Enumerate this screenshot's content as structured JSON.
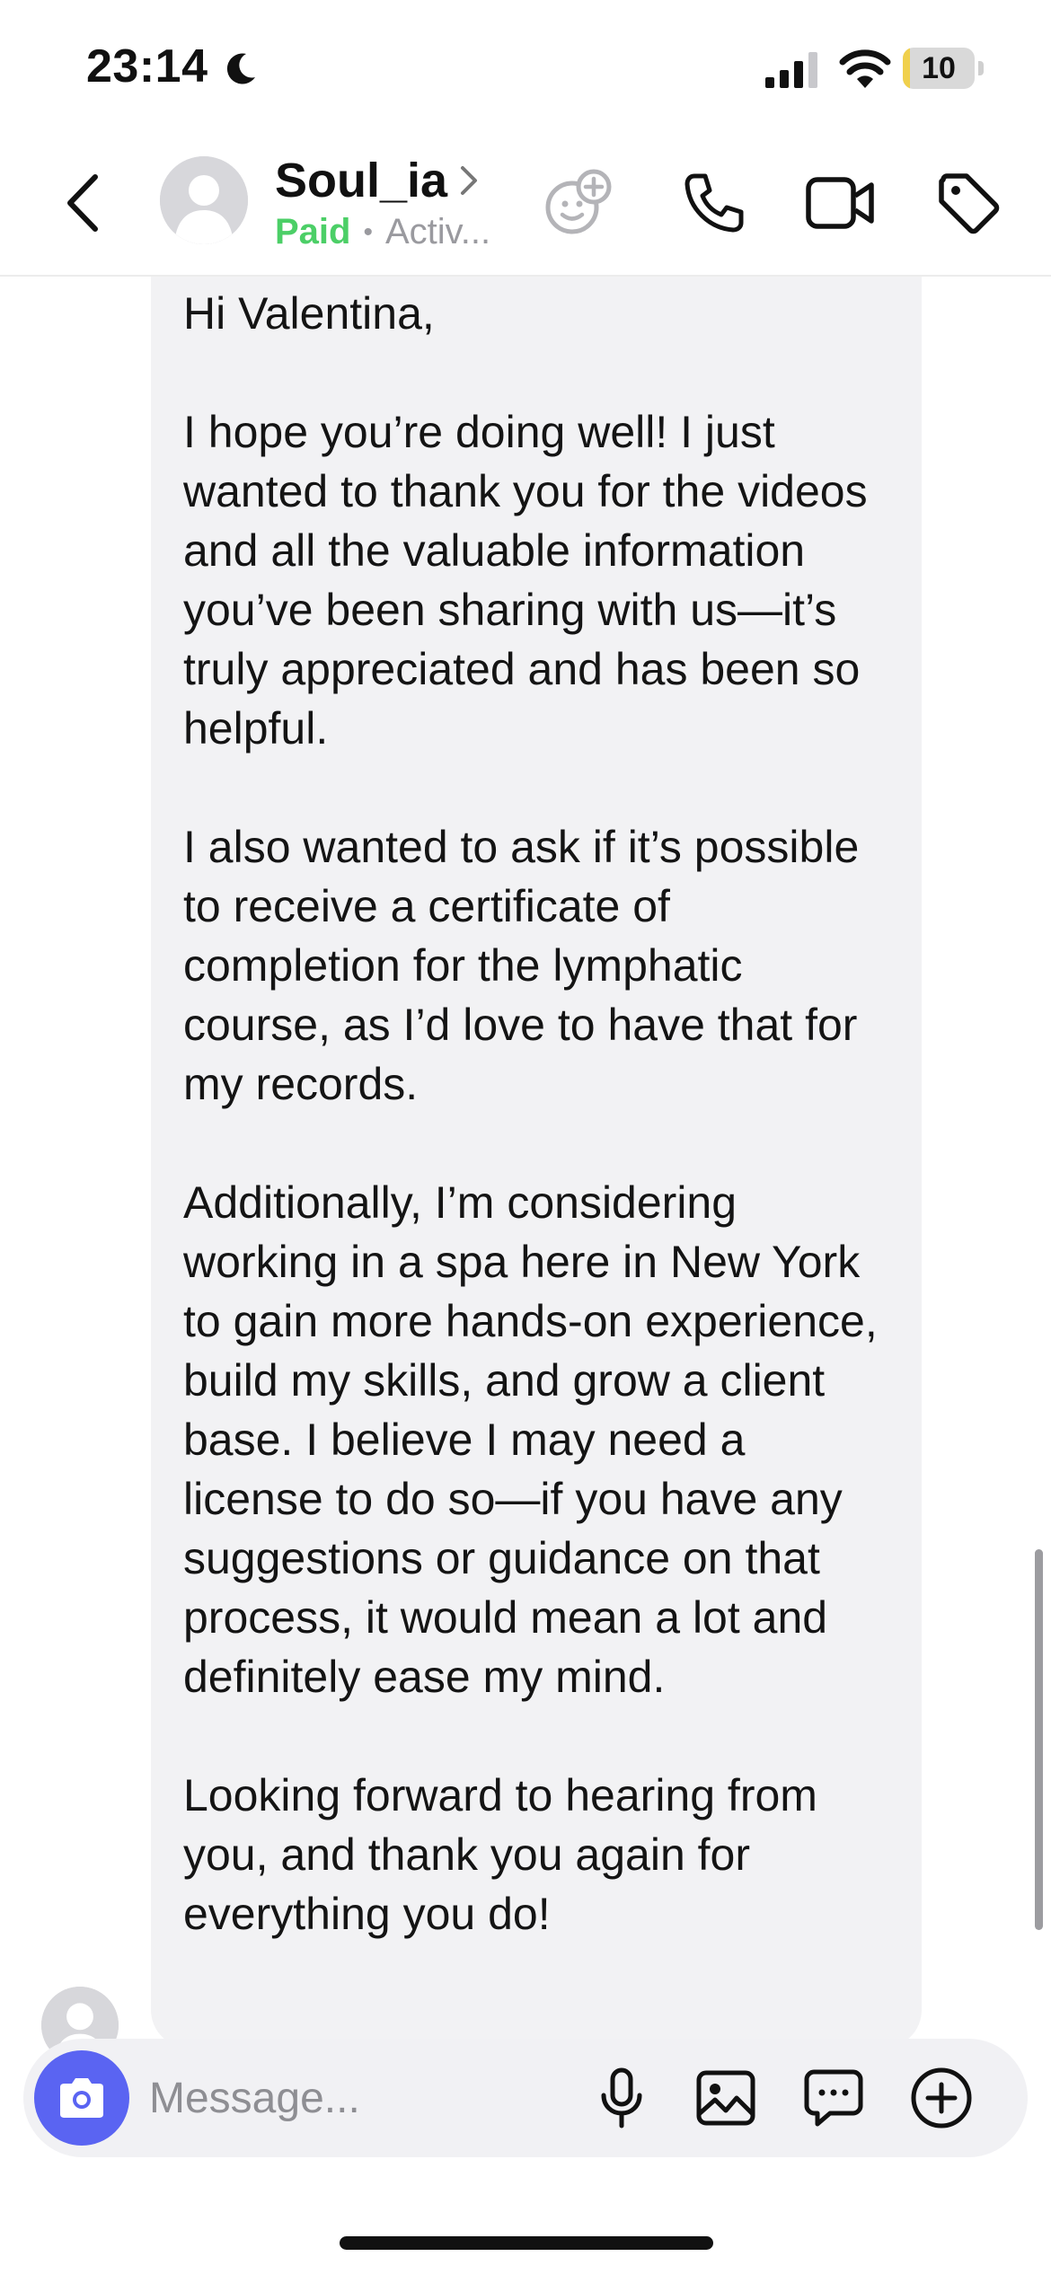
{
  "status_bar": {
    "time": "23:14",
    "battery_level": "10",
    "battery_fraction": 0.1,
    "battery_color": "#f0d04c",
    "icons": [
      "moon-icon",
      "signal-icon",
      "wifi-icon",
      "battery-icon"
    ]
  },
  "header": {
    "contact_name": "Soul_ia",
    "paid_label": "Paid",
    "separator": "•",
    "activity": "Activ...",
    "paid_color": "#4ccf67",
    "icons": [
      "back-chevron-icon",
      "avatar-placeholder-icon",
      "chevron-right-icon",
      "add-emoji-icon",
      "phone-icon",
      "video-camera-icon",
      "tag-icon"
    ]
  },
  "message": {
    "body": "Hi Valentina,\n\nI hope you’re doing well! I just wanted to thank you for the videos and all the valuable information you’ve been sharing with us—it’s truly appreciated and has been so helpful.\n\nI also wanted to ask if it’s possible to receive a certificate of completion for the lymphatic course, as I’d love to have that for my records.\n\nAdditionally, I’m considering working in a spa here in New York to gain more hands-on experience, build my skills, and grow a client base. I believe I may need a license to do so—if you have any suggestions or guidance on that process, it would mean a lot and definitely ease my mind.\n\nLooking forward to hearing from you, and thank you again for everything you do!"
  },
  "composer": {
    "placeholder": "Message...",
    "accent_color": "#5a64f2",
    "icons": [
      "camera-icon",
      "microphone-icon",
      "image-icon",
      "chat-bubble-icon",
      "plus-circle-icon"
    ]
  }
}
